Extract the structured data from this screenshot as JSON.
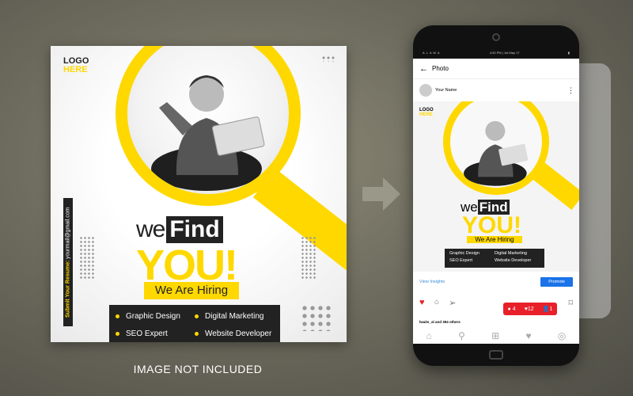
{
  "post": {
    "logo_line1": "LOGO",
    "logo_line2": "HERE",
    "vertical_label": "Submit Your Resume:",
    "vertical_email": "yourmail@gmail.com",
    "headline_we": "we",
    "headline_find": "Find",
    "headline_you": "YOU!",
    "subheadline": "We Are Hiring",
    "skills": [
      "Graphic Design",
      "Digital Marketing",
      "SEO Expert",
      "Website Developer"
    ],
    "accent_color": "#ffd800",
    "dark_color": "#222222"
  },
  "phone": {
    "status": {
      "carrier": "ALAMA",
      "time": "4:30 PM | 1st May 17"
    },
    "header": {
      "back_icon": "arrow-left-icon",
      "title": "Photo"
    },
    "user": {
      "name": "Your Name",
      "menu_icon": "more-vertical-icon"
    },
    "insights": {
      "link": "View Insights",
      "promote": "Promote"
    },
    "notifications": {
      "comments": "4",
      "likes": "12",
      "followers": "1"
    },
    "likes_text": "lwaits_al and 394 others",
    "nav_icons": [
      "home-icon",
      "search-icon",
      "add-icon",
      "heart-icon",
      "profile-icon"
    ]
  },
  "caption": "IMAGE NOT INCLUDED"
}
